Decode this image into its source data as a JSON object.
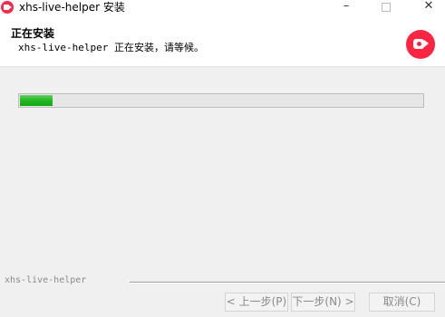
{
  "window": {
    "title": "xhs-live-helper 安装",
    "minimize": "–",
    "close": "✕"
  },
  "header": {
    "title": "正在安装",
    "subtitle": "xhs-live-helper 正在安装，请等候。"
  },
  "progress": {
    "value_percent": 8,
    "fill_color": "#23b523"
  },
  "branding": "xhs-live-helper",
  "buttons": {
    "back": "< 上一步(P)",
    "next": "下一步(N) >",
    "cancel": "取消(C)"
  },
  "colors": {
    "brand": "#ff2442"
  }
}
